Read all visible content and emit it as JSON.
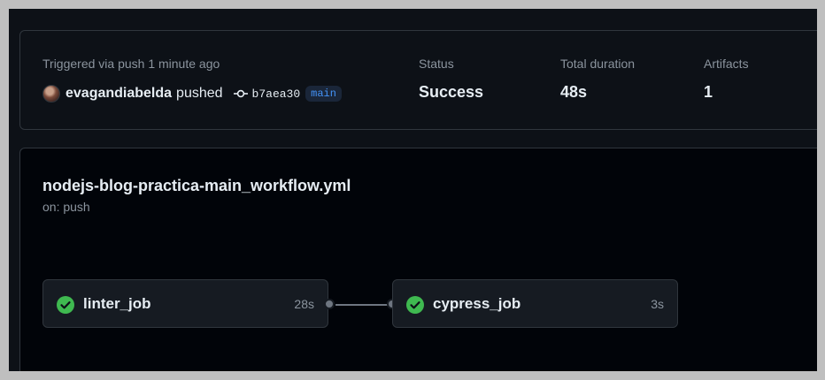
{
  "run_summary": {
    "trigger_text": "Triggered via push 1 minute ago",
    "username": "evagandiabelda",
    "action": "pushed",
    "commit_sha": "b7aea30",
    "branch": "main",
    "status_label": "Status",
    "status_value": "Success",
    "duration_label": "Total duration",
    "duration_value": "48s",
    "artifacts_label": "Artifacts",
    "artifacts_value": "1"
  },
  "workflow": {
    "filename": "nodejs-blog-practica-main_workflow.yml",
    "trigger": "on: push",
    "jobs": [
      {
        "name": "linter_job",
        "duration": "28s",
        "status": "success",
        "icon": "check-circle-icon"
      },
      {
        "name": "cypress_job",
        "duration": "3s",
        "status": "success",
        "icon": "check-circle-icon"
      }
    ]
  },
  "colors": {
    "success": "#3fb950",
    "branch_text": "#4493f8",
    "branch_bg": "#1a2639",
    "text_primary": "#e6edf3",
    "text_muted": "#8b949e"
  }
}
